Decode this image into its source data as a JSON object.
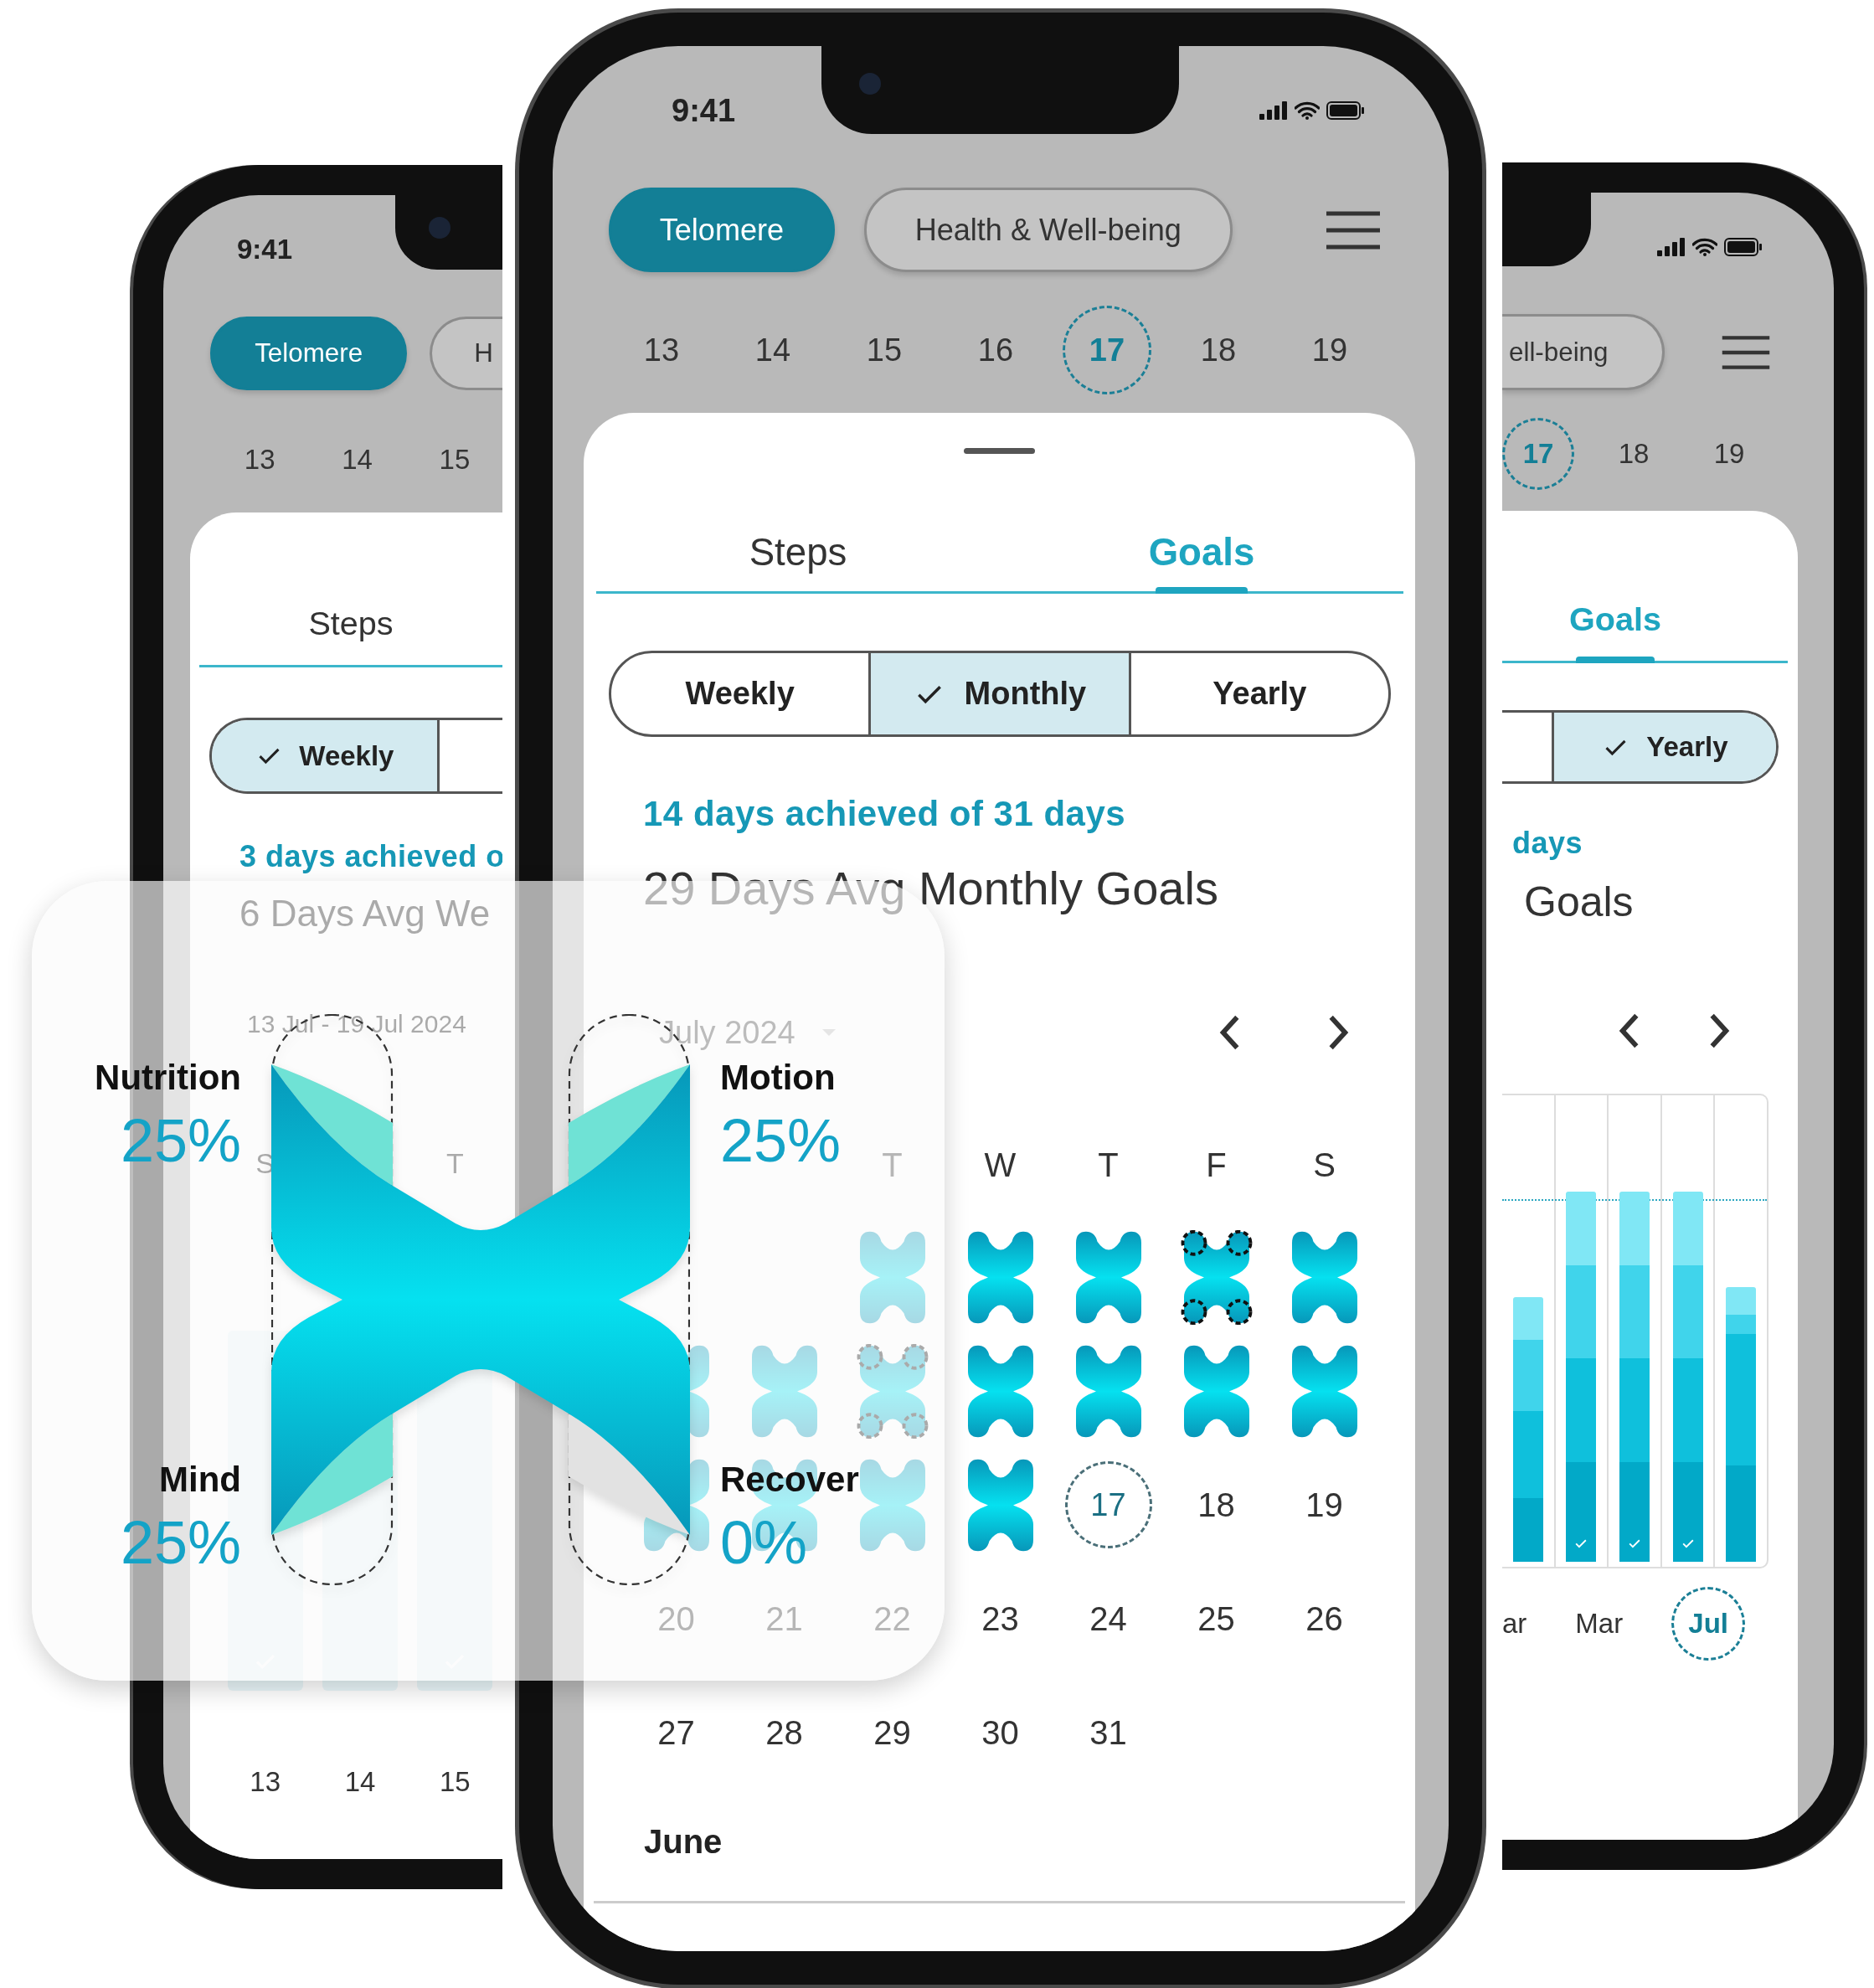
{
  "left_phone": {
    "status_bar": {
      "time": "9:41"
    },
    "pills": [
      {
        "label": "Telomere",
        "selected": true
      },
      {
        "label": "H",
        "selected": false
      }
    ],
    "dates": [
      {
        "label": "13",
        "selected": false
      },
      {
        "label": "14",
        "selected": false
      },
      {
        "label": "15",
        "selected": false
      }
    ],
    "tabs": [
      {
        "label": "Steps",
        "selected": false
      }
    ],
    "periods": [
      {
        "label": "Weekly",
        "selected": true
      }
    ],
    "achievement": "3 days achieved o",
    "title": "6 Days Avg We",
    "date_range": "13 Jul - 19 Jul 2024",
    "chart_weekdays": [
      {
        "kind": "label",
        "label": "S"
      },
      {
        "kind": "blank"
      },
      {
        "kind": "label",
        "label": "T"
      }
    ],
    "bottom_dates": [
      "13",
      "14",
      "15"
    ]
  },
  "center_phone": {
    "status_bar": {
      "time": "9:41"
    },
    "pills": [
      {
        "label": "Telomere",
        "selected": true
      },
      {
        "label": "Health & Well-being",
        "selected": false
      }
    ],
    "dates": [
      {
        "label": "13",
        "selected": false
      },
      {
        "label": "14",
        "selected": false
      },
      {
        "label": "15",
        "selected": false
      },
      {
        "label": "16",
        "selected": false
      },
      {
        "label": "17",
        "selected": true
      },
      {
        "label": "18",
        "selected": false
      },
      {
        "label": "19",
        "selected": false
      }
    ],
    "tabs": [
      {
        "label": "Steps",
        "selected": false
      },
      {
        "label": "Goals",
        "selected": true
      }
    ],
    "periods": [
      {
        "label": "Weekly",
        "selected": false
      },
      {
        "label": "Monthly",
        "selected": true
      },
      {
        "label": "Yearly",
        "selected": false
      }
    ],
    "achievement": "14 days achieved of 31 days",
    "title": "29 Days Avg Monthly Goals",
    "calendar": {
      "month": "July 2024",
      "weekdays": [
        {
          "kind": "blank"
        },
        {
          "kind": "blank"
        },
        {
          "kind": "label",
          "label": "T"
        },
        {
          "kind": "label",
          "label": "W"
        },
        {
          "kind": "label",
          "label": "T"
        },
        {
          "kind": "label",
          "label": "F"
        },
        {
          "kind": "label",
          "label": "S"
        }
      ],
      "weeks": [
        [
          {
            "kind": "blank"
          },
          {
            "kind": "blank"
          },
          {
            "kind": "goal",
            "complete": true
          },
          {
            "kind": "goal",
            "complete": true
          },
          {
            "kind": "goal",
            "complete": true
          },
          {
            "kind": "goal",
            "complete": false
          },
          {
            "kind": "goal",
            "complete": true
          }
        ],
        [
          {
            "kind": "goal",
            "complete": true
          },
          {
            "kind": "goal",
            "complete": true
          },
          {
            "kind": "goal",
            "complete": false
          },
          {
            "kind": "goal",
            "complete": true
          },
          {
            "kind": "goal",
            "complete": true
          },
          {
            "kind": "goal",
            "complete": true
          },
          {
            "kind": "goal",
            "complete": true
          }
        ],
        [
          {
            "kind": "goal",
            "complete": true
          },
          {
            "kind": "goal",
            "complete": true
          },
          {
            "kind": "goal",
            "complete": true
          },
          {
            "kind": "goal",
            "complete": true
          },
          {
            "kind": "today",
            "label": "17"
          },
          {
            "kind": "day",
            "label": "18"
          },
          {
            "kind": "day",
            "label": "19"
          }
        ],
        [
          {
            "kind": "day",
            "label": "20"
          },
          {
            "kind": "day",
            "label": "21"
          },
          {
            "kind": "day",
            "label": "22"
          },
          {
            "kind": "day",
            "label": "23"
          },
          {
            "kind": "day",
            "label": "24"
          },
          {
            "kind": "day",
            "label": "25"
          },
          {
            "kind": "day",
            "label": "26"
          }
        ],
        [
          {
            "kind": "day",
            "label": "27"
          },
          {
            "kind": "day",
            "label": "28"
          },
          {
            "kind": "day",
            "label": "29"
          },
          {
            "kind": "day",
            "label": "30"
          },
          {
            "kind": "day",
            "label": "31"
          },
          {
            "kind": "blank"
          },
          {
            "kind": "blank"
          }
        ]
      ]
    },
    "footer_month": "June"
  },
  "right_phone": {
    "pills": [
      {
        "label": "ell-being",
        "selected": false
      }
    ],
    "dates": [
      {
        "label": "17",
        "selected": true
      },
      {
        "label": "18",
        "selected": false
      },
      {
        "label": "19",
        "selected": false
      }
    ],
    "tabs": [
      {
        "label": "Goals",
        "selected": true
      }
    ],
    "periods": [
      {
        "label": "Yearly",
        "selected": true
      }
    ],
    "achievement": "days",
    "title": "Goals",
    "months": [
      {
        "label": "ar",
        "selected": false
      },
      {
        "label": "Mar",
        "selected": false
      },
      {
        "label": "Jul",
        "selected": true
      }
    ]
  },
  "overlay": {
    "metrics": [
      {
        "label": "Nutrition",
        "value": "25%",
        "level": 0.25
      },
      {
        "label": "Motion",
        "value": "25%",
        "level": 0.25
      },
      {
        "label": "Mind",
        "value": "25%",
        "level": 0.25
      },
      {
        "label": "Recover",
        "value": "0%",
        "level": 0
      }
    ]
  }
}
